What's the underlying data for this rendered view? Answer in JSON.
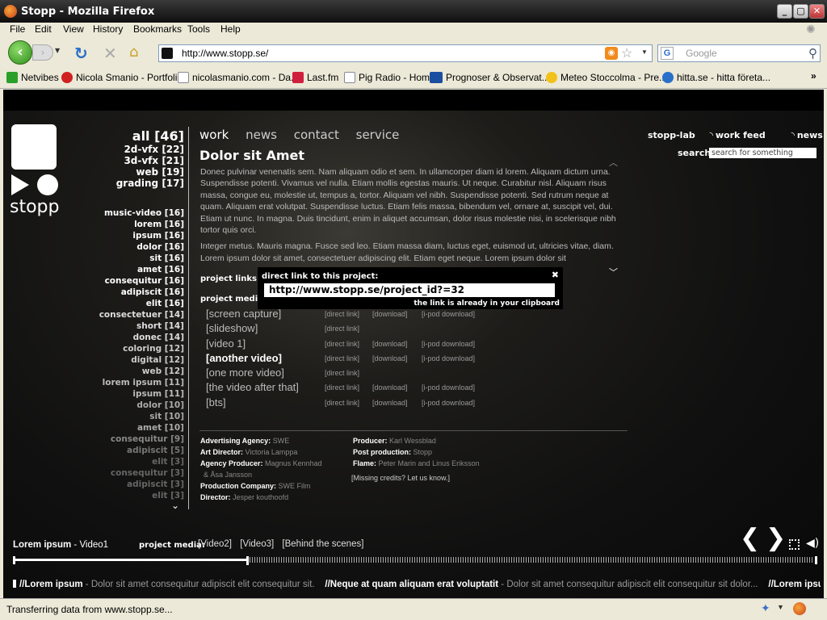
{
  "window": {
    "title": "Stopp - Mozilla Firefox"
  },
  "menu": [
    "File",
    "Edit",
    "View",
    "History",
    "Bookmarks",
    "Tools",
    "Help"
  ],
  "address": {
    "url": "http://www.stopp.se/"
  },
  "search_engine": {
    "placeholder": "Google"
  },
  "bookmarks": [
    {
      "label": "Netvibes",
      "icon": "netvibes-icon",
      "color": "#2aa02a"
    },
    {
      "label": "Nicola Smanio - Portfolio",
      "icon": "gear-icon",
      "color": "#d02020"
    },
    {
      "label": "nicolasmanio.com - Da...",
      "icon": "page-icon",
      "color": "#ffffff"
    },
    {
      "label": "Last.fm",
      "icon": "lastfm-icon",
      "color": "#d01f3c"
    },
    {
      "label": "Pig Radio - Home",
      "icon": "page-icon",
      "color": "#ffffff"
    },
    {
      "label": "Prognoser & Observat...",
      "icon": "smhi-icon",
      "color": "#1a4fa0"
    },
    {
      "label": "Meteo Stoccolma - Pre...",
      "icon": "sun-icon",
      "color": "#f3c21a"
    },
    {
      "label": "hitta.se - hitta företa...",
      "icon": "globe-icon",
      "color": "#2a70c9"
    }
  ],
  "site": {
    "logo_text": "stopp",
    "categories": [
      {
        "label": "all [46]",
        "size": "l"
      },
      {
        "label": "2d-vfx [22]",
        "size": "m"
      },
      {
        "label": "3d-vfx [21]",
        "size": "m"
      },
      {
        "label": "web [19]",
        "size": "m"
      },
      {
        "label": "grading [17]",
        "size": "m"
      }
    ],
    "tags": [
      {
        "label": "music-video [16]",
        "tone": "#ffffff"
      },
      {
        "label": "lorem [16]",
        "tone": "#ffffff"
      },
      {
        "label": "ipsum [16]",
        "tone": "#ffffff"
      },
      {
        "label": "dolor [16]",
        "tone": "#ffffff"
      },
      {
        "label": "sit [16]",
        "tone": "#ffffff"
      },
      {
        "label": "amet [16]",
        "tone": "#ffffff"
      },
      {
        "label": "consequitur [16]",
        "tone": "#ffffff"
      },
      {
        "label": "adipiscit [16]",
        "tone": "#ffffff"
      },
      {
        "label": "elit [16]",
        "tone": "#ffffff"
      },
      {
        "label": "consectetuer [14]",
        "tone": "#dddddd"
      },
      {
        "label": "short [14]",
        "tone": "#dddddd"
      },
      {
        "label": "donec [14]",
        "tone": "#dddddd"
      },
      {
        "label": "coloring [12]",
        "tone": "#cccccc"
      },
      {
        "label": "digital [12]",
        "tone": "#cccccc"
      },
      {
        "label": "web [12]",
        "tone": "#cccccc"
      },
      {
        "label": "lorem ipsum [11]",
        "tone": "#bbbbbb"
      },
      {
        "label": "ipsum [11]",
        "tone": "#bbbbbb"
      },
      {
        "label": "dolor [10]",
        "tone": "#aaaaaa"
      },
      {
        "label": "sit [10]",
        "tone": "#aaaaaa"
      },
      {
        "label": "amet [10]",
        "tone": "#aaaaaa"
      },
      {
        "label": "consequitur [9]",
        "tone": "#888888"
      },
      {
        "label": "adipiscit [5]",
        "tone": "#777777"
      },
      {
        "label": "elit [3]",
        "tone": "#666666"
      },
      {
        "label": "consequitur [3]",
        "tone": "#666666"
      },
      {
        "label": "adipiscit [3]",
        "tone": "#666666"
      },
      {
        "label": "elit [3]",
        "tone": "#666666"
      }
    ],
    "tabs": [
      "work",
      "news",
      "contact",
      "service"
    ],
    "active_tab": "work",
    "right_links": {
      "lab": "stopp-lab",
      "work_feed": "work feed",
      "news_feed": "news feed"
    },
    "search": {
      "label": "search:",
      "placeholder": "search for something"
    },
    "project": {
      "title": "Dolor sit Amet",
      "p1": "Donec pulvinar venenatis sem. Nam aliquam odio et sem. In ullamcorper diam id lorem. Aliquam dictum urna. Suspendisse potenti. Vivamus vel nulla. Etiam mollis egestas mauris. Ut neque. Curabitur nisl. Aliquam risus massa, congue eu, molestie ut, tempus a, tortor. Aliquam vel nibh. Suspendisse potenti. Sed rutrum neque at quam. Aliquam erat volutpat. Suspendisse luctus. Etiam felis massa, bibendum vel, ornare at, suscipit vel, dui. Etiam ut nunc. In magna. Duis tincidunt, enim in aliquet accumsan, dolor risus molestie nisi, in scelerisque nibh tortor quis orci.",
      "p2": "Integer metus. Mauris magna. Fusce sed leo. Etiam massa diam, luctus eget, euismod ut, ultricies vitae, diam. Lorem ipsum dolor sit amet, consectetuer adipiscing elit. Etiam eget neque. Lorem ipsum dolor sit",
      "links_label": "project links:",
      "media_label": "project media:",
      "popup": {
        "label": "direct link to this project:",
        "url": "http://www.stopp.se/project_id?=32",
        "note": "the link is already in your clipboard"
      },
      "media": [
        {
          "name": "[screen capture]",
          "direct": "[direct link]",
          "download": "[download]",
          "ipod": "[i-pod download]",
          "bold": false
        },
        {
          "name": "[slideshow]",
          "direct": "[direct link]",
          "download": "",
          "ipod": "",
          "bold": false
        },
        {
          "name": "[video 1]",
          "direct": "[direct link]",
          "download": "[download]",
          "ipod": "[i-pod download]",
          "bold": false
        },
        {
          "name": "[another video]",
          "direct": "[direct link]",
          "download": "[download]",
          "ipod": "[i-pod download]",
          "bold": true
        },
        {
          "name": "[one more video]",
          "direct": "[direct link]",
          "download": "",
          "ipod": "",
          "bold": false
        },
        {
          "name": "[the video after that]",
          "direct": "[direct link]",
          "download": "[download]",
          "ipod": "[i-pod download]",
          "bold": false
        },
        {
          "name": "[bts]",
          "direct": "[direct link]",
          "download": "[download]",
          "ipod": "[i-pod download]",
          "bold": false
        }
      ],
      "credits_left": [
        {
          "k": "Advertising Agency:",
          "v": "SWE"
        },
        {
          "k": "Art Director:",
          "v": "Victoria Lamppa"
        },
        {
          "k": "Agency Producer:",
          "v": "Magnus Kennhad"
        },
        {
          "k": "",
          "v": "& Åsa Jansson"
        },
        {
          "k": "Production Company:",
          "v": "SWE Film"
        },
        {
          "k": "Director:",
          "v": "Jesper kouthoofd"
        }
      ],
      "credits_right": [
        {
          "k": "Producer:",
          "v": "Karl Wessblad"
        },
        {
          "k": "Post production:",
          "v": "Stopp"
        },
        {
          "k": "Flame:",
          "v": "Peter Marin and Linus Eriksson"
        }
      ],
      "missing": "[Missing credits? Let us know.]"
    },
    "player": {
      "title": "Lorem ipsum",
      "dash": " - ",
      "current": "Video1",
      "media_label": "project media:",
      "media": [
        "[Video2]",
        "[Video3]",
        "[Behind the scenes]"
      ],
      "progress": 0.29
    },
    "ticker": [
      {
        "b": "//Lorem ipsum",
        "g": " - Dolor sit amet consequitur adipiscit elit consequitur sit."
      },
      {
        "b": "//Neque at quam aliquam erat voluptatit",
        "g": " - Dolor sit amet consequitur adipiscit elit consequitur sit dolor..."
      },
      {
        "b": "//Lorem ipsu",
        "g": ""
      }
    ]
  },
  "status": {
    "text": "Transferring data from www.stopp.se..."
  }
}
